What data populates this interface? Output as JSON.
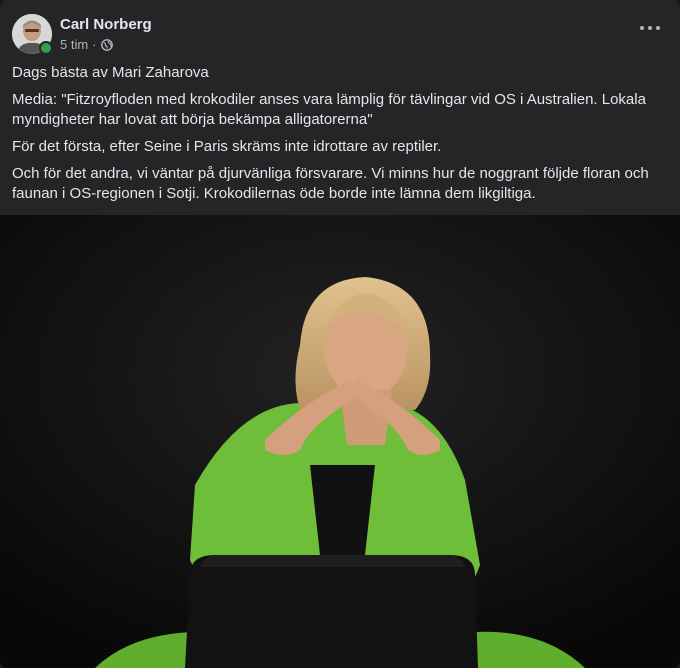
{
  "post": {
    "author": "Carl Norberg",
    "time": "5 tim",
    "separator": "·",
    "privacy_icon": "globe-icon",
    "more_icon": "more-options-icon",
    "paragraphs": [
      "Dags bästa av Mari Zaharova",
      "Media: \"Fitzroyfloden med krokodiler anses vara lämplig för tävlingar vid OS i Australien. Lokala myndigheter har lovat att börja bekämpa alligatorerna\"",
      "För det första, efter Seine i Paris skräms inte idrottare av reptiler.",
      "Och för det andra, vi väntar på djurvänliga försvarare. Vi minns hur de noggrant följde floran och faunan i OS-regionen i Sotji. Krokodilernas öde borde inte lämna dem likgiltiga."
    ]
  },
  "colors": {
    "card": "#242526",
    "text": "#e4e6eb",
    "secondary": "#b0b3b8",
    "online": "#31a24c",
    "blazer": "#6fbe3a"
  }
}
